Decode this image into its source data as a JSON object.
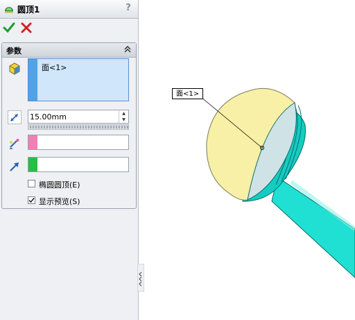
{
  "window": {
    "title": "圆顶1",
    "help_icon": "?"
  },
  "actions": {
    "ok_icon": "checkmark-icon",
    "cancel_icon": "x-icon"
  },
  "params": {
    "title": "参数",
    "face_item": "面<1>",
    "distance": "15.00mm",
    "checkbox_elliptical": {
      "label": "椭圆圆顶(E)",
      "checked": false
    },
    "checkbox_preview": {
      "label": "显示预览(S)",
      "checked": true
    },
    "colors": {
      "face": "#4fa3e6",
      "pink": "#f07fb4",
      "green": "#22c043"
    }
  },
  "viewport": {
    "face_tag": "面<1>"
  }
}
